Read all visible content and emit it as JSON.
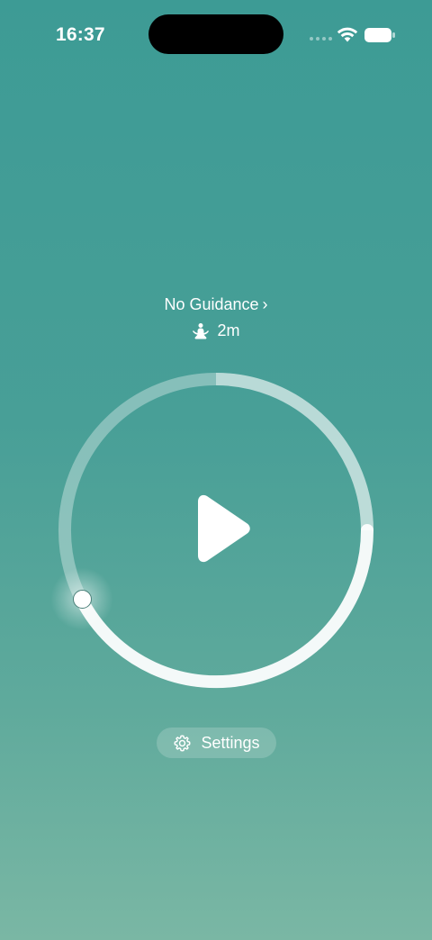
{
  "status_bar": {
    "time": "16:37",
    "wifi_icon": "wifi-icon",
    "battery_icon": "battery-icon"
  },
  "session": {
    "guidance_label": "No Guidance",
    "guidance_chevron": "›",
    "duration_icon": "meditate-icon",
    "duration": "2m"
  },
  "timer": {
    "play_icon": "play-icon",
    "handle_icon": "dial-handle"
  },
  "footer": {
    "settings_icon": "gear-icon",
    "settings_label": "Settings"
  },
  "colors": {
    "background_top": "#3d9b95",
    "background_bottom": "#7ab7a4",
    "foreground": "#ffffff"
  }
}
